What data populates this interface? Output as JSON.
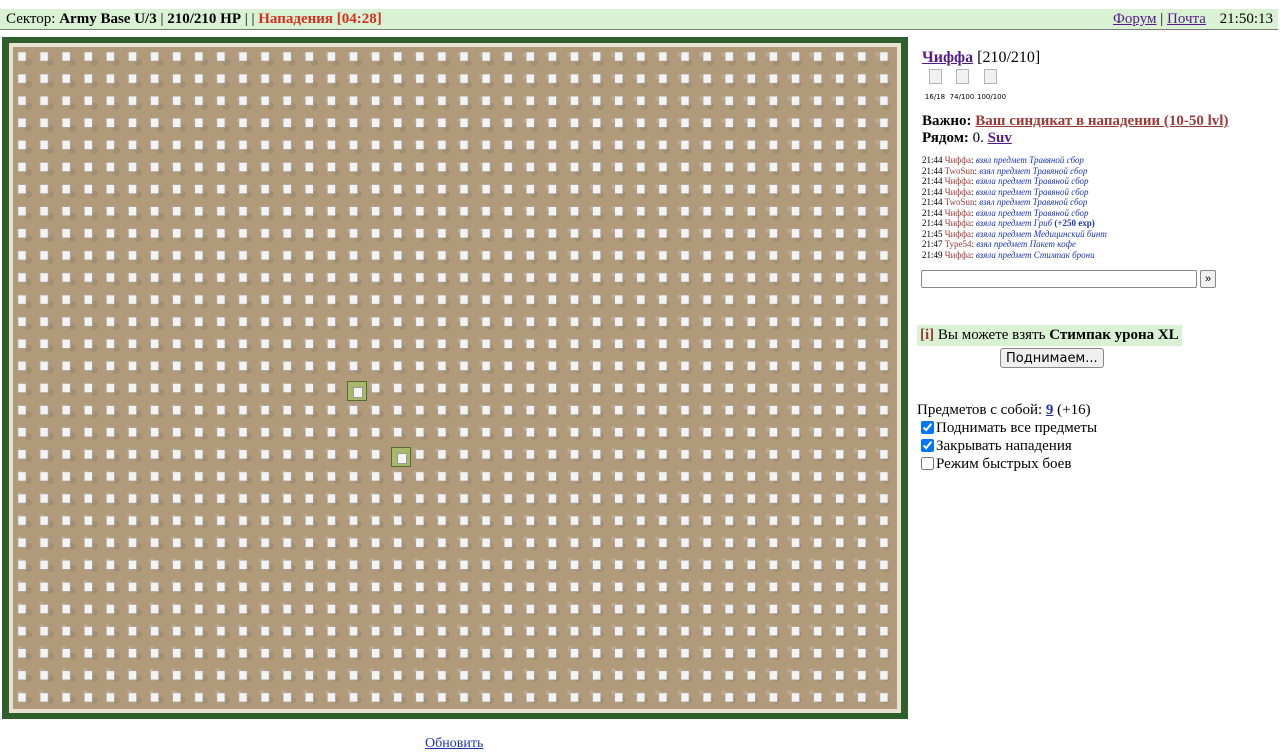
{
  "topbar": {
    "sector_prefix": "Сектор:",
    "sector_name": "Army Base U/3",
    "hp": "210/210 HP",
    "sep1": "|",
    "sep2": "| |",
    "attack": "Нападения [04:28]",
    "forum": "Форум",
    "mail": "Почта",
    "sep3": "|",
    "time": "21:50:13"
  },
  "character": {
    "name": "Чиффа",
    "hp": "[210/210]",
    "stats": [
      "16/18",
      "74/100",
      "100/100"
    ]
  },
  "important": {
    "label": "Важно:",
    "link": "Ваш синдикат в нападении (10-50 lvl)"
  },
  "nearby": {
    "label": "Рядом:",
    "count": "0.",
    "link": "Suv"
  },
  "log": [
    {
      "time": "21:44",
      "name": "Чиффа",
      "action": "взял предмет Травяной сбор",
      "extra": ""
    },
    {
      "time": "21:44",
      "name": "TwoSun",
      "action": "взял предмет Травяной сбор",
      "extra": ""
    },
    {
      "time": "21:44",
      "name": "Чиффа",
      "action": "взяла предмет Травяной сбор",
      "extra": ""
    },
    {
      "time": "21:44",
      "name": "Чиффа",
      "action": "взяла предмет Травяной сбор",
      "extra": ""
    },
    {
      "time": "21:44",
      "name": "TwoSun",
      "action": "взял предмет Травяной сбор",
      "extra": ""
    },
    {
      "time": "21:44",
      "name": "Чиффа",
      "action": "взяла предмет Травяной сбор",
      "extra": ""
    },
    {
      "time": "21:44",
      "name": "Чиффа",
      "action": "взяла предмет Гриб",
      "extra": "(+250 exp)"
    },
    {
      "time": "21:45",
      "name": "Чиффа",
      "action": "взяла предмет Медицинский бинт",
      "extra": ""
    },
    {
      "time": "21:47",
      "name": "Type54",
      "action": "взял предмет Пакет кофе",
      "extra": ""
    },
    {
      "time": "21:49",
      "name": "Чиффа",
      "action": "взяла предмет Стимпак брони",
      "extra": ""
    }
  ],
  "chat": {
    "send_label": "»",
    "value": ""
  },
  "pickup": {
    "info_tag": "[i]",
    "text": "Вы можете взять",
    "item": "Стимпак урона XL",
    "button": "Поднимаем..."
  },
  "carry": {
    "label": "Предметов с собой:",
    "count": "9",
    "extra": "(+16)"
  },
  "options": [
    {
      "label": "Поднимать все предметы",
      "checked": true
    },
    {
      "label": "Закрывать нападения",
      "checked": true
    },
    {
      "label": "Режим быстрых боев",
      "checked": false
    }
  ],
  "refresh": "Обновить",
  "colors": {
    "topbar_bg": "#d9f2d3",
    "attack_red": "#d43021",
    "map_border": "#2f5f2c",
    "link_visited": "#551a8b",
    "log_name": "#9c3a36",
    "log_action": "#1d34b5"
  }
}
